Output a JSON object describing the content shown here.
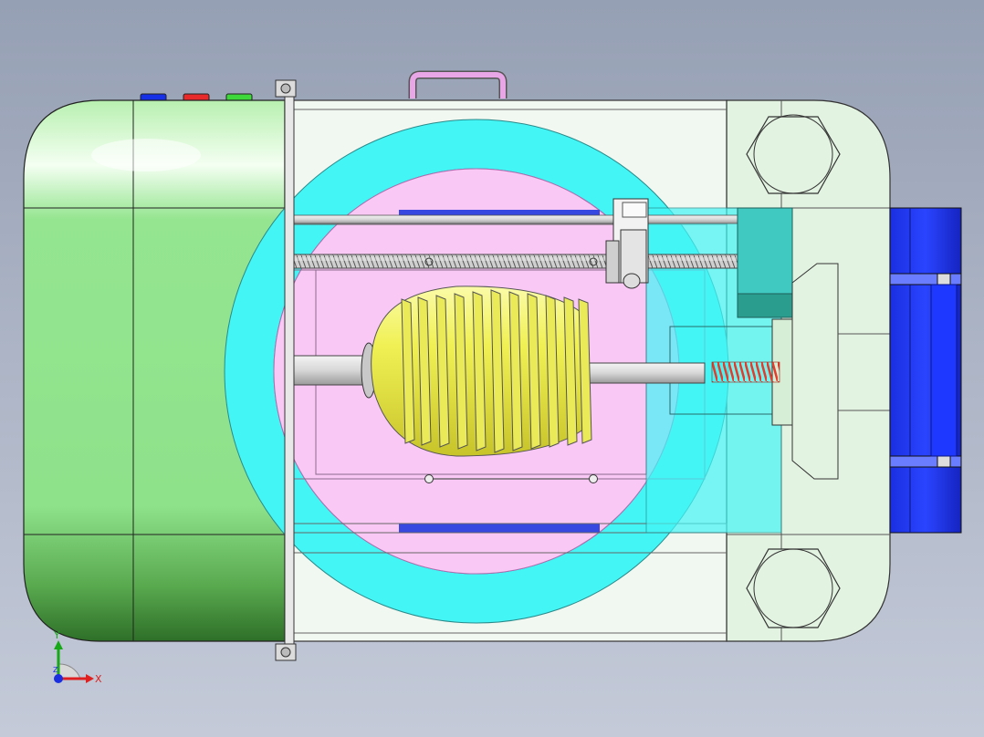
{
  "colors": {
    "background_top": "#96a0b4",
    "background_bottom": "#c4cad8",
    "tank_green": "#8ee28a",
    "tank_green_dark": "#3f8f36",
    "glass_body": "#eef6ee",
    "cyan_ring": "#44f5f6",
    "pink_panel": "#f9c8f5",
    "yellow_drum": "#f0f054",
    "blue_motor": "#1530e6",
    "red_spring": "#e83a2a",
    "teal_block": "#2a9d8f",
    "handle_pink": "#e9a6e6",
    "outline": "#2a2a2a"
  },
  "icons": {
    "drum": "spiral-drum-icon",
    "screw": "lead-screw-icon",
    "spring": "compression-spring-icon",
    "bolt": "hex-bolt-icon",
    "triad": "axis-triad-icon"
  },
  "triad": {
    "x_label": "X",
    "y_label": "Y",
    "z_label": "Z"
  }
}
